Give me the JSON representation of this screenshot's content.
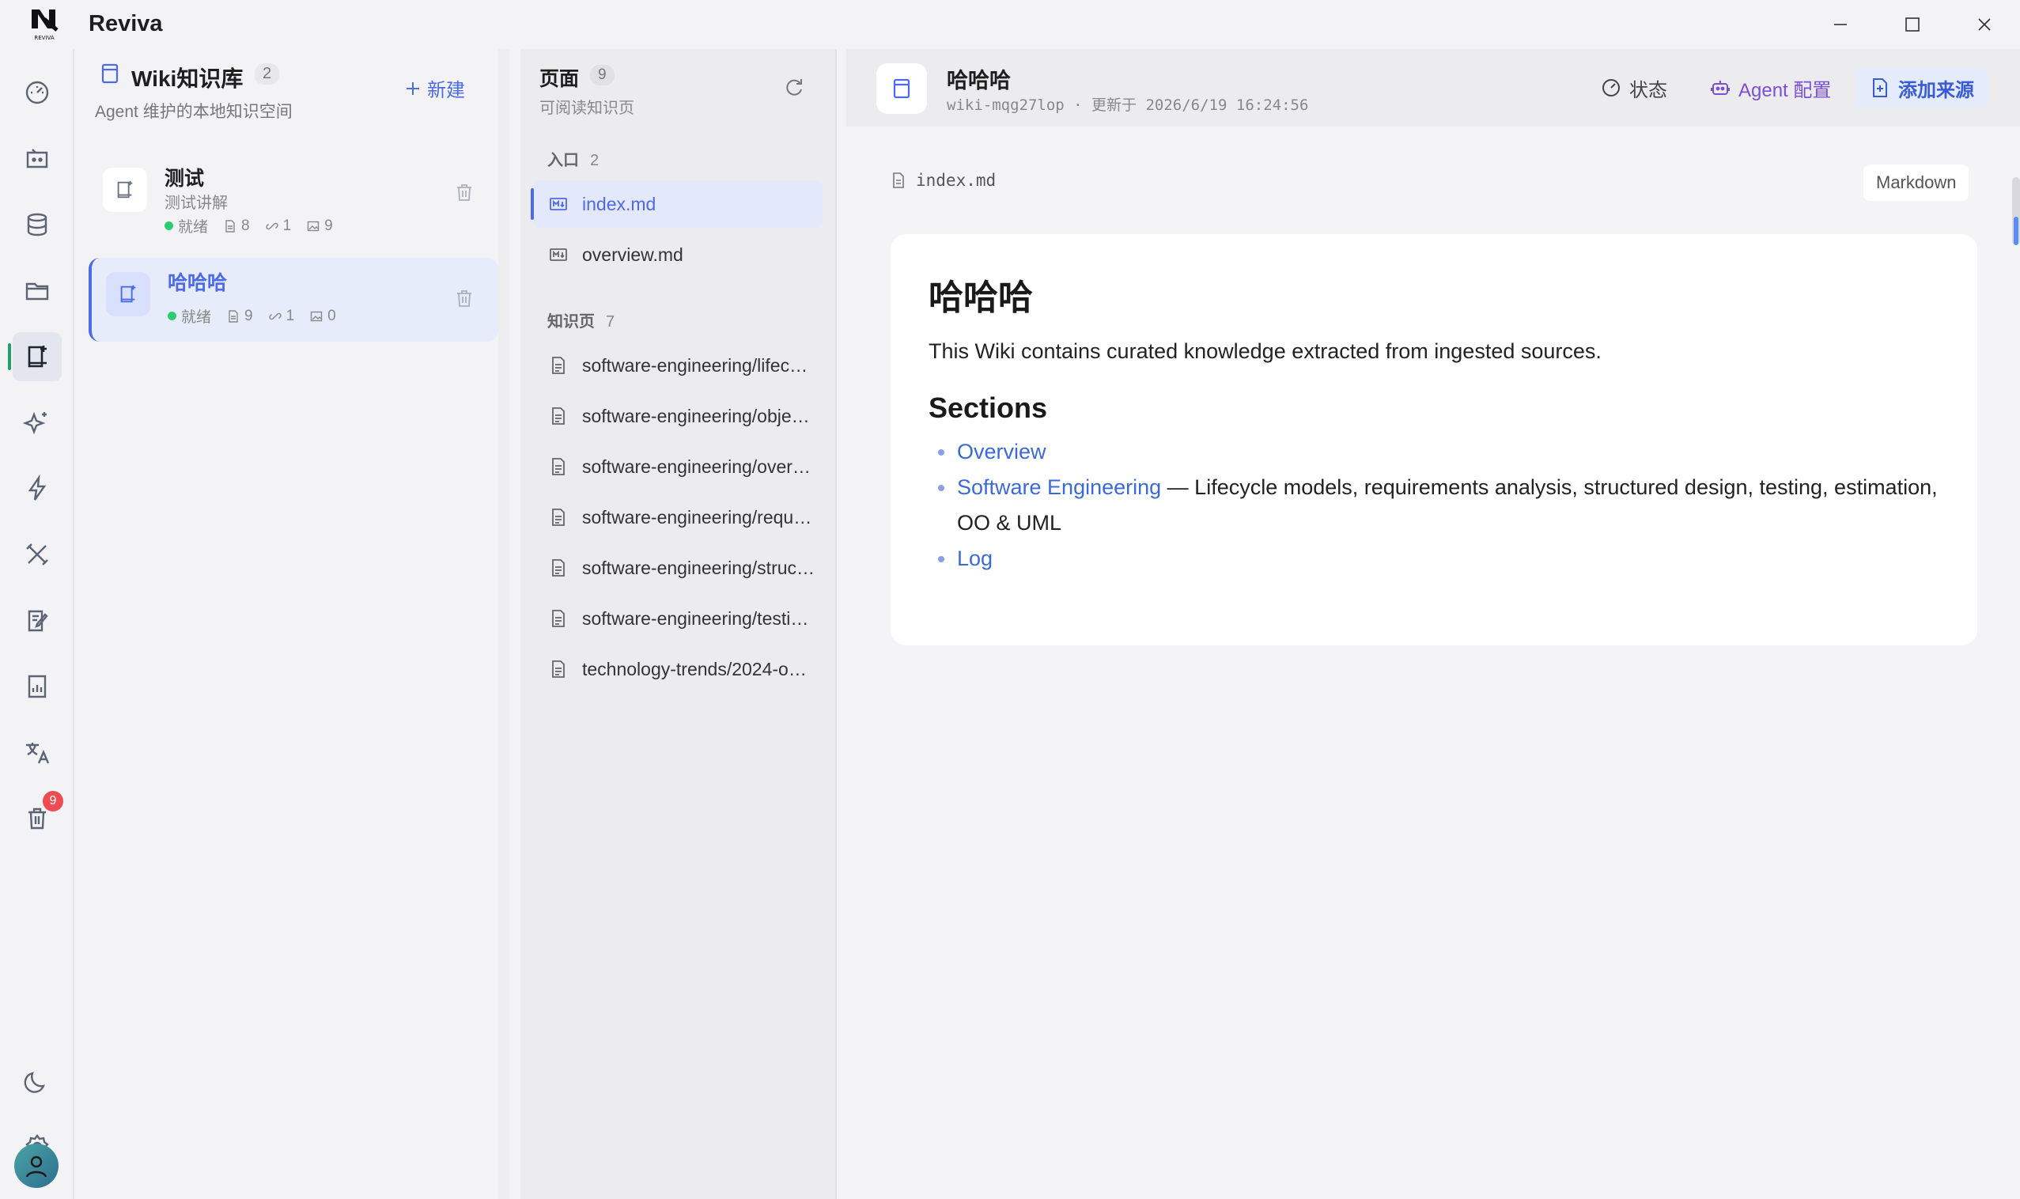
{
  "app": {
    "title": "Reviva",
    "logo_text": "REVIVA"
  },
  "window": {
    "minimize": "minimize-icon",
    "maximize": "maximize-icon",
    "close": "close-icon"
  },
  "rail": {
    "items": [
      "dashboard-icon",
      "agent-icon",
      "database-icon",
      "folder-icon",
      "wiki-icon",
      "sparkle-icon",
      "bolt-icon",
      "tools-icon",
      "edit-icon",
      "report-icon",
      "translate-icon",
      "trash-icon"
    ],
    "trash_badge": "9",
    "bottom": [
      "moon-icon",
      "gear-icon",
      "avatar"
    ]
  },
  "wiki_panel": {
    "title": "Wiki知识库",
    "count": "2",
    "subtitle": "Agent 维护的本地知识空间",
    "new_label": "新建",
    "items": [
      {
        "name": "测试",
        "desc": "测试讲解",
        "status": "就绪",
        "docs": "8",
        "links": "1",
        "images": "9"
      },
      {
        "name": "哈哈哈",
        "desc": "",
        "status": "就绪",
        "docs": "9",
        "links": "1",
        "images": "0"
      }
    ]
  },
  "pages_panel": {
    "title": "页面",
    "count": "9",
    "subtitle": "可阅读知识页",
    "entry_label": "入口",
    "entry_count": "2",
    "entries": [
      "index.md",
      "overview.md"
    ],
    "knowledge_label": "知识页",
    "knowledge_count": "7",
    "knowledge": [
      "software-engineering/lifec…",
      "software-engineering/obje…",
      "software-engineering/over…",
      "software-engineering/requ…",
      "software-engineering/struc…",
      "software-engineering/testi…",
      "technology-trends/2024-o…"
    ]
  },
  "main": {
    "title": "哈哈哈",
    "id": "wiki-mqg27lop",
    "updated": "· 更新于 2026/6/19 16:24:56",
    "status_label": "状态",
    "agent_label": "Agent 配置",
    "add_source_label": "添加来源",
    "file_name": "index.md",
    "format": "Markdown",
    "doc": {
      "h1": "哈哈哈",
      "intro": "This Wiki contains curated knowledge extracted from ingested sources.",
      "h2": "Sections",
      "links": {
        "overview": "Overview",
        "se": "Software Engineering",
        "se_desc": " — Lifecycle models, requirements analysis, structured design, testing, estimation, OO & UML",
        "log": "Log"
      }
    }
  },
  "colors": {
    "accent": "#4d6ae8",
    "link": "#3b6ad6",
    "ready": "#2ecc71",
    "badge": "#ef4b52",
    "agent": "#7a4fd6"
  }
}
